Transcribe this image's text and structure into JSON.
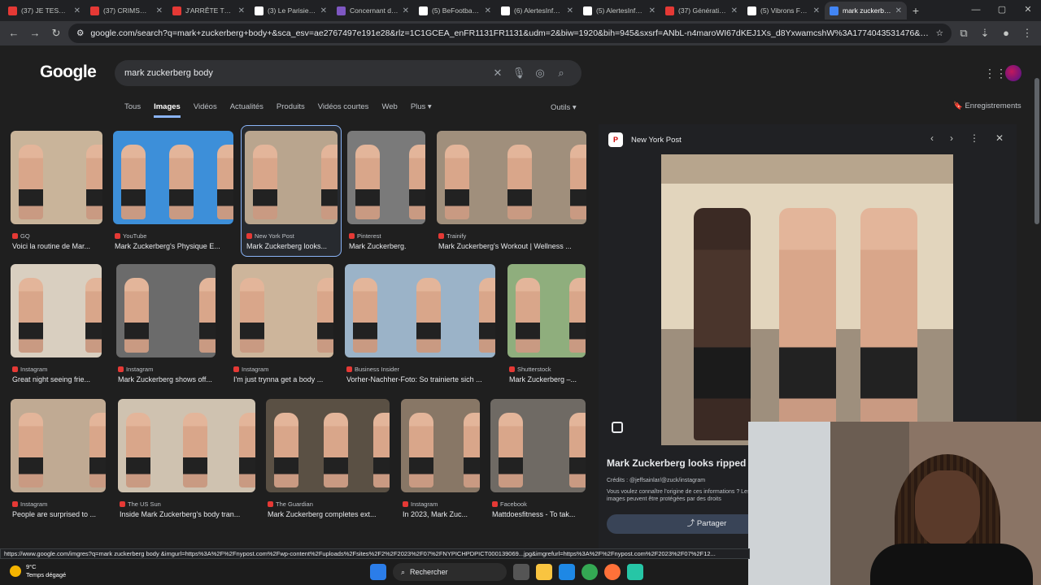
{
  "tabs": [
    {
      "label": "(37) JE TESTE L...",
      "color": "#e53935"
    },
    {
      "label": "(37) CRIMSON...",
      "color": "#e53935"
    },
    {
      "label": "J'ARRÊTE TOUT...",
      "color": "#e53935"
    },
    {
      "label": "(3) Le Parisien...",
      "color": "#ffffff"
    },
    {
      "label": "Concernant de...",
      "color": "#7e57c2"
    },
    {
      "label": "(5) BeFootball...",
      "color": "#ffffff"
    },
    {
      "label": "(6) AlertesInfo...",
      "color": "#ffffff"
    },
    {
      "label": "(5) AlertesInfo...",
      "color": "#ffffff"
    },
    {
      "label": "(37) Génération...",
      "color": "#e53935"
    },
    {
      "label": "(5) Vibrons Fo...",
      "color": "#ffffff"
    },
    {
      "label": "mark zuckerbe...",
      "color": "#4285f4"
    }
  ],
  "address": {
    "url": "google.com/search?q=mark+zuckerberg+body+&sca_esv=ae2767497e191e28&rlz=1C1GCEA_enFR1131FR1131&udm=2&biw=1920&bih=945&sxsrf=ANbL-n4maroWI67dKEJ1Xs_d8YxwamcshW%3A1774043531476&ei=i8G9afjlHP7s7M8PuK_IuQY&..."
  },
  "google": {
    "logo": "Google",
    "query": "mark zuckerberg body",
    "filters": [
      "Tous",
      "Images",
      "Vidéos",
      "Actualités",
      "Produits",
      "Vidéos courtes",
      "Web",
      "Plus ▾"
    ],
    "tools": "Outils ▾",
    "saved": "Enregistrements"
  },
  "results": [
    {
      "source": "GQ",
      "caption": "Voici la routine de Mar..."
    },
    {
      "source": "YouTube",
      "caption": "Mark Zuckerberg's Physique E..."
    },
    {
      "source": "New York Post",
      "caption": "Mark Zuckerberg looks..."
    },
    {
      "source": "Pinterest",
      "caption": "Mark Zuckerberg."
    },
    {
      "source": "Trainify",
      "caption": "Mark Zuckerberg's Workout | Wellness ..."
    },
    {
      "source": "Instagram",
      "caption": "Great night seeing frie..."
    },
    {
      "source": "Instagram",
      "caption": "Mark Zuckerberg shows off..."
    },
    {
      "source": "Instagram",
      "caption": "I'm just trynna get a body ..."
    },
    {
      "source": "Business Insider",
      "caption": "Vorher-Nachher-Foto: So trainierte sich ..."
    },
    {
      "source": "Shutterstock",
      "caption": "Mark Zuckerberg –..."
    },
    {
      "source": "Instagram",
      "caption": "People are surprised to ..."
    },
    {
      "source": "The US Sun",
      "caption": "Inside Mark Zuckerberg's body tran..."
    },
    {
      "source": "The Guardian",
      "caption": "Mark Zuckerberg completes ext..."
    },
    {
      "source": "Instagram",
      "caption": "In 2023, Mark Zuc..."
    },
    {
      "source": "Facebook",
      "caption": "Mattdoesfitness - To tak..."
    }
  ],
  "panel": {
    "source": "New York Post",
    "title": "Mark Zuckerberg looks ripped in",
    "credits": "Crédits : @jeffsainlar/@zuck/instagram",
    "note": "Vous voulez connaître l'origine de ces informations ? Les images peuvent être protégées par des droits",
    "share": "Partager"
  },
  "status_url": "https://www.google.com/imgres?q=mark zuckerberg body &imgurl=https%3A%2F%2Fnypost.com%2Fwp-content%2Fuploads%2Fsites%2F2%2F2023%2F07%2FNYPICHPDPICT000139069...jpg&imgrefurl=https%3A%2F%2Fnypost.com%2F2023%2F07%2F12...",
  "taskbar": {
    "temp": "9°C",
    "weather": "Temps dégagé",
    "search": "Rechercher"
  }
}
